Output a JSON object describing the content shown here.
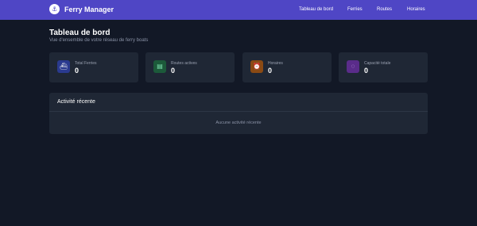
{
  "app": {
    "brand": "Ferry Manager",
    "logo_glyph": "⚓"
  },
  "nav": {
    "dashboard": "Tableau de bord",
    "ferries": "Ferries",
    "routes": "Routes",
    "schedules": "Horaires"
  },
  "page": {
    "title": "Tableau de bord",
    "subtitle": "Vue d'ensemble de votre réseau de ferry boats"
  },
  "stats": [
    {
      "label": "Total Ferries",
      "value": "0",
      "icon": "ferry-icon",
      "color": "#2a3a8f"
    },
    {
      "label": "Routes actives",
      "value": "0",
      "icon": "route-icon",
      "color": "#1c5a3a"
    },
    {
      "label": "Horaires",
      "value": "0",
      "icon": "clock-icon",
      "color": "#8a4a14"
    },
    {
      "label": "Capacité totale",
      "value": "0",
      "icon": "users-icon",
      "color": "#5a2c8a"
    }
  ],
  "activity": {
    "title": "Activité récente",
    "empty_text": "Aucune activité récente"
  },
  "colors": {
    "navbar": "#4f46c5",
    "background": "#121826",
    "card": "#1f2735"
  }
}
